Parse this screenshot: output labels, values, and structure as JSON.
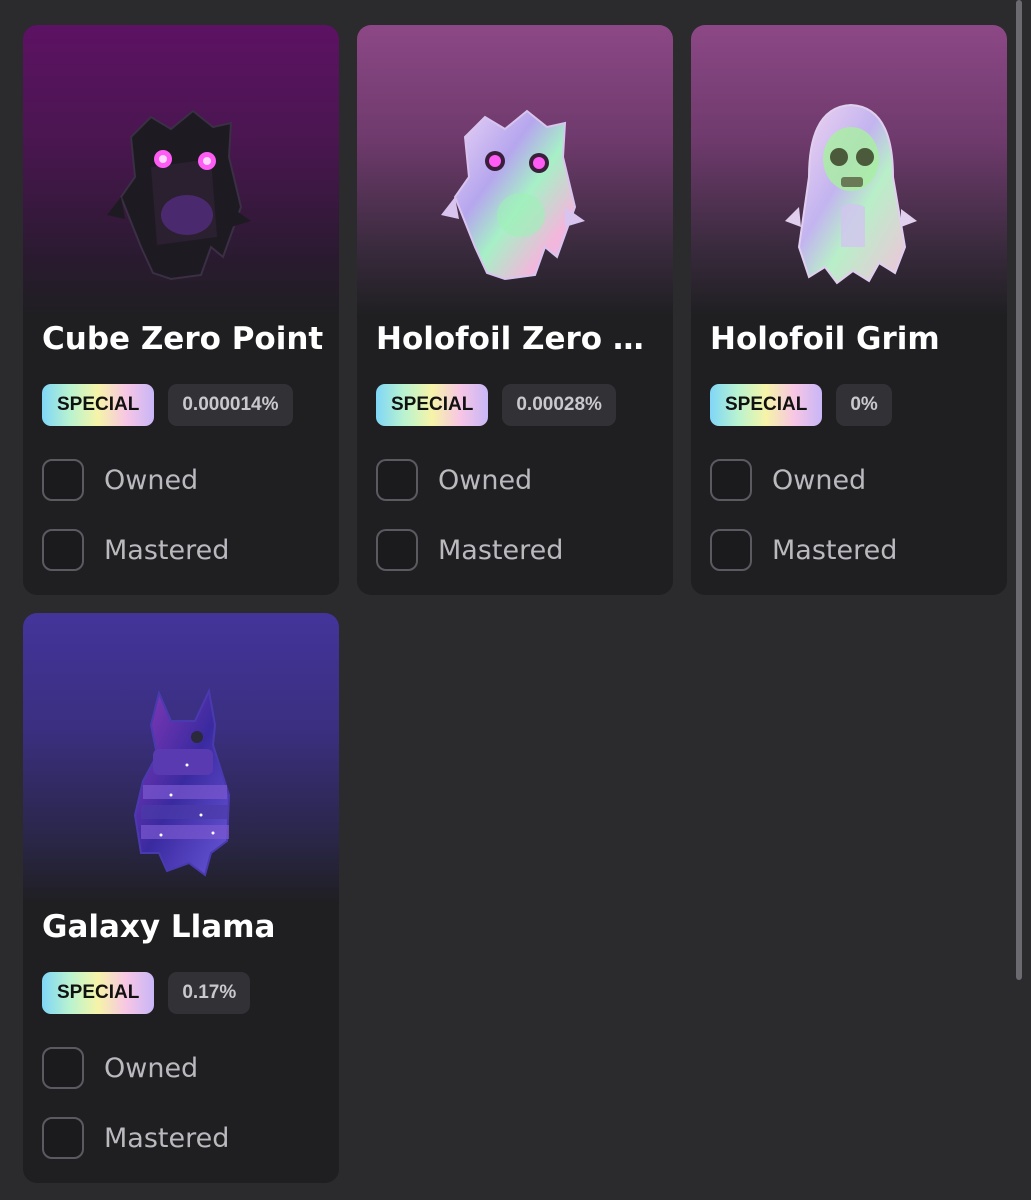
{
  "cards": [
    {
      "name": "Cube Zero Point",
      "rarity": "SPECIAL",
      "percentage": "0.000014%",
      "owned_label": "Owned",
      "mastered_label": "Mastered",
      "owned": false,
      "mastered": false,
      "image_icon": "cube-creature-icon",
      "bg_color": "#5d1263"
    },
    {
      "name": "Holofoil Zero Point",
      "rarity": "SPECIAL",
      "percentage": "0.00028%",
      "owned_label": "Owned",
      "mastered_label": "Mastered",
      "owned": false,
      "mastered": false,
      "image_icon": "holo-cube-creature-icon",
      "bg_color": "#8c4886"
    },
    {
      "name": "Holofoil Grim",
      "rarity": "SPECIAL",
      "percentage": "0%",
      "owned_label": "Owned",
      "mastered_label": "Mastered",
      "owned": false,
      "mastered": false,
      "image_icon": "hooded-skull-icon",
      "bg_color": "#8c4886"
    },
    {
      "name": "Galaxy Llama",
      "rarity": "SPECIAL",
      "percentage": "0.17%",
      "owned_label": "Owned",
      "mastered_label": "Mastered",
      "owned": false,
      "mastered": false,
      "image_icon": "llama-pinata-icon",
      "bg_color": "#43349a"
    }
  ]
}
